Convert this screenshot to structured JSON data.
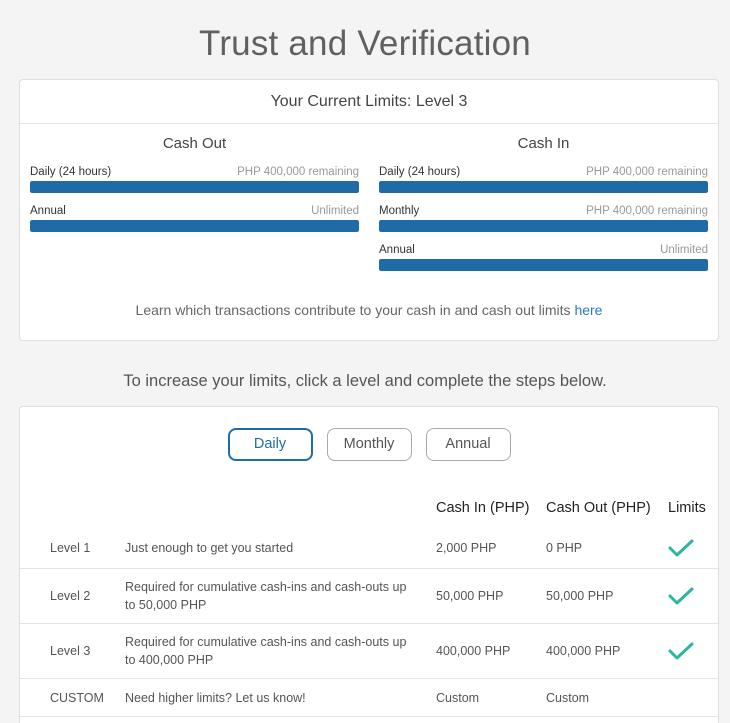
{
  "page": {
    "title": "Trust and Verification"
  },
  "current_limits": {
    "header": "Your Current Limits: Level 3",
    "cash_out": {
      "title": "Cash Out",
      "meters": [
        {
          "label": "Daily (24 hours)",
          "value": "PHP 400,000 remaining",
          "fill_fraction": 1.0
        },
        {
          "label": "Annual",
          "value": "Unlimited",
          "fill_fraction": 1.0
        }
      ]
    },
    "cash_in": {
      "title": "Cash In",
      "meters": [
        {
          "label": "Daily (24 hours)",
          "value": "PHP 400,000 remaining",
          "fill_fraction": 1.0
        },
        {
          "label": "Monthly",
          "value": "PHP 400,000 remaining",
          "fill_fraction": 1.0
        },
        {
          "label": "Annual",
          "value": "Unlimited",
          "fill_fraction": 1.0
        }
      ]
    },
    "learn_text": "Learn which transactions contribute to your cash in and cash out limits ",
    "learn_link": "here"
  },
  "increase": {
    "text": "To increase your limits, click a level and complete the steps below.",
    "periods": [
      "Daily",
      "Monthly",
      "Annual"
    ],
    "selected_period": "Daily",
    "columns": {
      "cash_in": "Cash In (PHP)",
      "cash_out": "Cash Out (PHP)",
      "limits": "Limits"
    },
    "rows": [
      {
        "level": "Level 1",
        "desc": "Just enough to get you started",
        "cash_in": "2,000 PHP",
        "cash_out": "0 PHP",
        "completed": true
      },
      {
        "level": "Level 2",
        "desc": "Required for cumulative cash-ins and cash-outs up to 50,000 PHP",
        "cash_in": "50,000 PHP",
        "cash_out": "50,000 PHP",
        "completed": true
      },
      {
        "level": "Level 3",
        "desc": "Required for cumulative cash-ins and cash-outs up to 400,000 PHP",
        "cash_in": "400,000 PHP",
        "cash_out": "400,000 PHP",
        "completed": true
      },
      {
        "level": "CUSTOM",
        "desc": "Need higher limits? Let us know!",
        "cash_in": "Custom",
        "cash_out": "Custom",
        "completed": false
      }
    ]
  },
  "colors": {
    "accent": "#1f6ba8",
    "check": "#2bb5a2",
    "link": "#2b78c5"
  },
  "icons": {
    "check": "check-icon"
  }
}
